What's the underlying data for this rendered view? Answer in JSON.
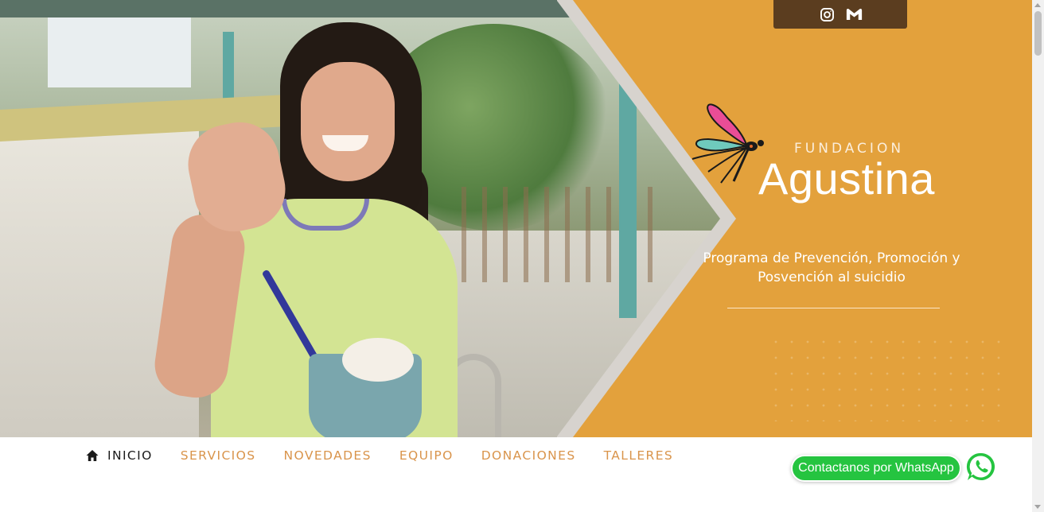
{
  "social": {
    "icons": [
      "instagram-icon",
      "gmail-icon"
    ]
  },
  "logo": {
    "small_text": "FUNDACION",
    "big_text": "Agustina"
  },
  "hero": {
    "tagline_line1": "Programa de Prevención, Promoción y",
    "tagline_line2": "Posvención al suicidio",
    "accent_color": "#e3a13c"
  },
  "nav": {
    "items": [
      {
        "label": "INICIO",
        "icon": "home-icon",
        "active": true
      },
      {
        "label": "SERVICIOS"
      },
      {
        "label": "NOVEDADES"
      },
      {
        "label": "EQUIPO"
      },
      {
        "label": "DONACIONES"
      },
      {
        "label": "TALLERES"
      }
    ],
    "active_color": "#1a1a1a",
    "item_color": "#d9944b"
  },
  "whatsapp": {
    "label": "Contactanos por WhatsApp",
    "icon": "whatsapp-icon",
    "color": "#25c440"
  }
}
